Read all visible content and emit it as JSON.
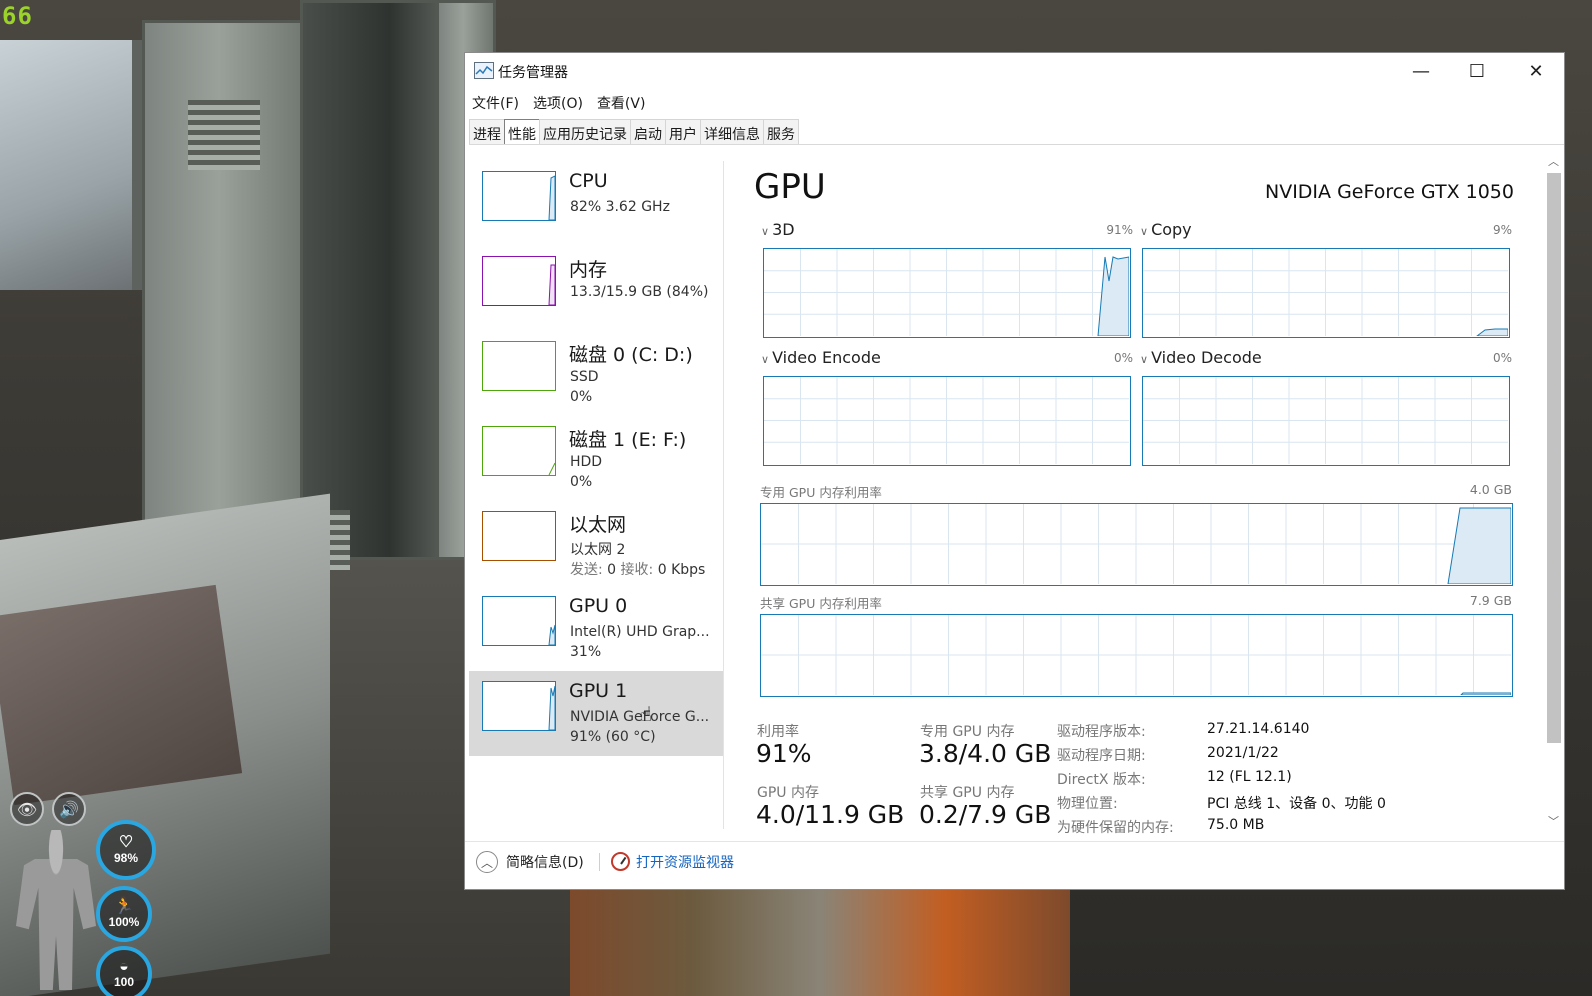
{
  "game": {
    "fps": "66",
    "hud": {
      "health": "98%",
      "stamina": "100%",
      "third": "100"
    }
  },
  "window": {
    "title": "任务管理器",
    "min_icon": "—",
    "max_icon": "☐",
    "close_icon": "✕"
  },
  "menu": [
    "文件(F)",
    "选项(O)",
    "查看(V)"
  ],
  "tabs": [
    {
      "label": "进程",
      "active": false
    },
    {
      "label": "性能",
      "active": true
    },
    {
      "label": "应用历史记录",
      "active": false
    },
    {
      "label": "启动",
      "active": false
    },
    {
      "label": "用户",
      "active": false
    },
    {
      "label": "详细信息",
      "active": false
    },
    {
      "label": "服务",
      "active": false
    }
  ],
  "sidebar": [
    {
      "title": "CPU",
      "line1": "82% 3.62 GHz",
      "line2": "",
      "color": "#177ab5"
    },
    {
      "title": "内存",
      "line1": "13.3/15.9 GB (84%)",
      "line2": "",
      "color": "#8b12ae"
    },
    {
      "title": "磁盘 0 (C: D:)",
      "line1": "SSD",
      "line2": "0%",
      "color": "#4da60c"
    },
    {
      "title": "磁盘 1 (E: F:)",
      "line1": "HDD",
      "line2": "0%",
      "color": "#4da60c"
    },
    {
      "title": "以太网",
      "line1": "以太网 2",
      "line2_send_label": "发送:",
      "line2_send": "0",
      "line2_recv_label": "接收:",
      "line2_recv": "0 Kbps",
      "color": "#a74f01"
    },
    {
      "title": "GPU 0",
      "line1": "Intel(R) UHD Grap...",
      "line2": "31%",
      "color": "#177ab5"
    },
    {
      "title": "GPU 1",
      "line1": "NVIDIA GeForce G...",
      "line2": "91% (60 °C)",
      "color": "#177ab5",
      "selected": true
    }
  ],
  "detail": {
    "title": "GPU",
    "device": "NVIDIA GeForce GTX 1050",
    "engines": [
      {
        "name": "3D",
        "pct": "91%",
        "level": 0.91
      },
      {
        "name": "Copy",
        "pct": "9%",
        "level": 0.09
      },
      {
        "name": "Video Encode",
        "pct": "0%",
        "level": 0
      },
      {
        "name": "Video Decode",
        "pct": "0%",
        "level": 0
      }
    ],
    "dedicated": {
      "label": "专用 GPU 内存利用率",
      "max": "4.0 GB",
      "level": 0.95
    },
    "shared": {
      "label": "共享 GPU 内存利用率",
      "max": "7.9 GB",
      "level": 0.03
    },
    "stats": {
      "util_label": "利用率",
      "util": "91%",
      "ded_label": "专用 GPU 内存",
      "ded": "3.8/4.0 GB",
      "gpumem_label": "GPU 内存",
      "gpumem": "4.0/11.9 GB",
      "shared_label": "共享 GPU 内存",
      "shared": "0.2/7.9 GB"
    },
    "info": [
      {
        "label": "驱动程序版本:",
        "value": "27.21.14.6140"
      },
      {
        "label": "驱动程序日期:",
        "value": "2021/1/22"
      },
      {
        "label": "DirectX 版本:",
        "value": "12 (FL 12.1)"
      },
      {
        "label": "物理位置:",
        "value": "PCI 总线 1、设备 0、功能 0"
      },
      {
        "label": "为硬件保留的内存:",
        "value": "75.0 MB"
      }
    ]
  },
  "footer": {
    "fewer": "简略信息(D)",
    "resmon": "打开资源监视器"
  }
}
